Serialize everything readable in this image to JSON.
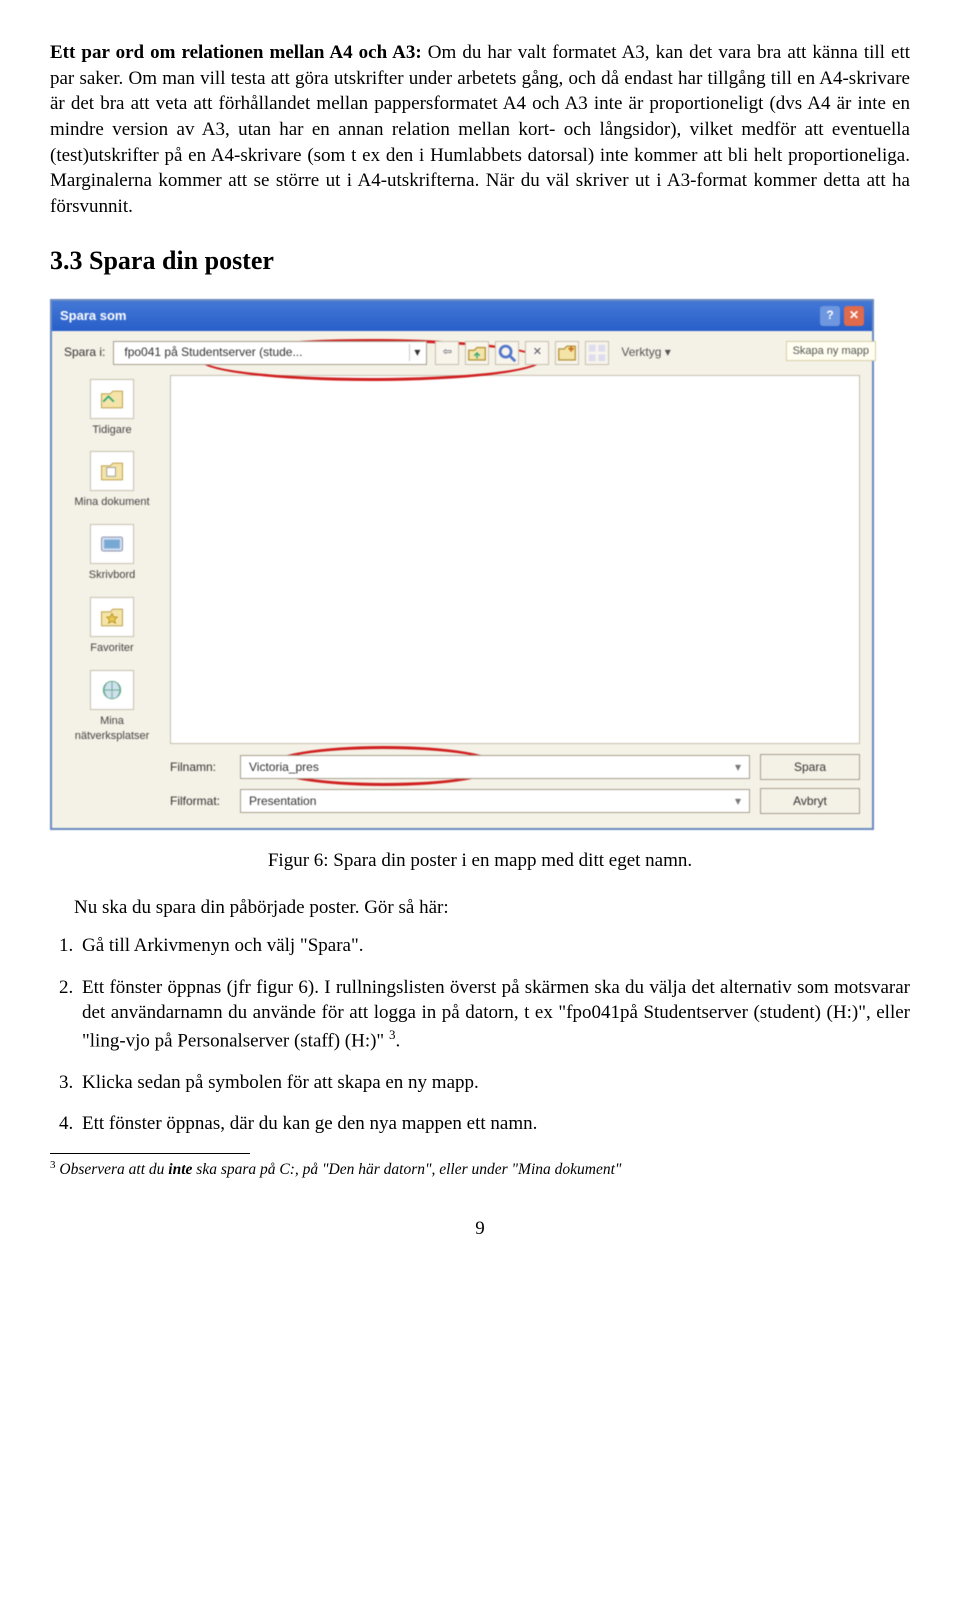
{
  "para1_bold": "Ett par ord om relationen mellan A4 och A3:",
  "para1_rest": " Om du har valt formatet A3, kan det vara bra att känna till ett par saker. Om man vill testa att göra utskrifter under arbetets gång, och då endast har tillgång till en A4-skrivare är det bra att veta att förhållandet mellan pappersformatet A4 och A3 inte är proportioneligt (dvs A4 är inte en mindre version av A3, utan har en annan relation mellan kort- och långsidor), vilket medför att eventuella (test)utskrifter på en A4-skrivare (som t ex den i Humlabbets datorsal) inte kommer att bli helt proportioneliga. Marginalerna kommer att se större ut i A4-utskrifterna. När du väl skriver ut i A3-format kommer detta att ha försvunnit.",
  "section_heading": "3.3   Spara din poster",
  "dialog": {
    "title": "Spara som",
    "spara_i_label": "Spara i:",
    "location": "fpo041 på Studentserver (stude...",
    "verktyg": "Verktyg",
    "skapa_ny_mapp": "Skapa ny mapp",
    "places": {
      "tidigare": "Tidigare",
      "mina_dokument": "Mina dokument",
      "skrivbord": "Skrivbord",
      "favoriter": "Favoriter",
      "natverk": "Mina nätverksplatser"
    },
    "filnamn_label": "Filnamn:",
    "filnamn_value": "Victoria_pres",
    "filformat_label": "Filformat:",
    "filformat_value": "Presentation",
    "spara_btn": "Spara",
    "avbryt_btn": "Avbryt"
  },
  "figure_caption": "Figur 6: Spara din poster i en mapp med ditt eget namn.",
  "intro_after_fig": "Nu ska du spara din påbörjade poster. Gör så här:",
  "steps": [
    "Gå till Arkivmenyn och välj \"Spara\".",
    "Ett fönster öppnas (jfr figur 6). I rullningslisten överst på skärmen ska du välja det alternativ som motsvarar det användarnamn du använde för att logga in på datorn, t ex \"fpo041på Studentserver (student) (H:)\", eller \"ling-vjo på Personalserver (staff) (H:)\" ",
    "Klicka sedan på symbolen för att skapa en ny mapp.",
    "Ett fönster öppnas, där du kan ge den nya mappen ett namn."
  ],
  "step2_footref": "3",
  "step2_tail": ".",
  "footnote_num": "3",
  "footnote_lead": "Observera att du ",
  "footnote_bold": "inte",
  "footnote_tail": " ska spara på C:, på \"Den här datorn\", eller under \"Mina dokument\"",
  "page_number": "9"
}
